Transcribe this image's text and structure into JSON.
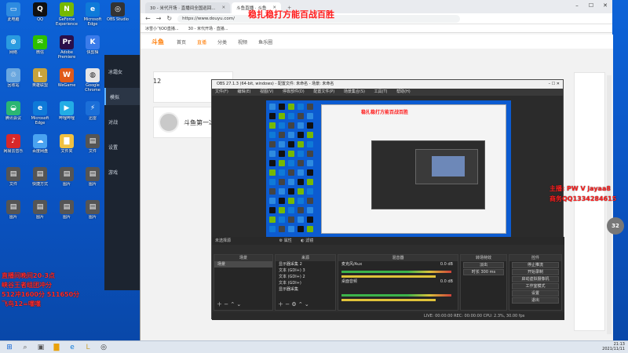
{
  "desktop": {
    "icons": [
      {
        "label": "此电脑",
        "color": "#2e8be0",
        "glyph": "▭"
      },
      {
        "label": "QQ",
        "color": "#111111",
        "glyph": "Q"
      },
      {
        "label": "GeForce Experience",
        "color": "#76b900",
        "glyph": "N"
      },
      {
        "label": "Microsoft Edge",
        "color": "#0f7ad8",
        "glyph": "e"
      },
      {
        "label": "OBS Studio",
        "color": "#333333",
        "glyph": "◎"
      },
      {
        "label": "网络",
        "color": "#2a9be0",
        "glyph": "⊕"
      },
      {
        "label": "微信",
        "color": "#2dc100",
        "glyph": "✉"
      },
      {
        "label": "Adobe Premiere",
        "color": "#2a0f4a",
        "glyph": "Pr"
      },
      {
        "label": "快剪辑",
        "color": "#3a7bea",
        "glyph": "K"
      },
      {
        "label": "小黄鸭",
        "color": "#f3c20a",
        "glyph": "◉"
      },
      {
        "label": "回收站",
        "color": "#6aa7df",
        "glyph": "♲"
      },
      {
        "label": "英雄联盟",
        "color": "#c8a33c",
        "glyph": "L"
      },
      {
        "label": "WeGame",
        "color": "#e05a1a",
        "glyph": "W"
      },
      {
        "label": "Google Chrome",
        "color": "#e6e6e6",
        "glyph": "◍"
      },
      {
        "label": "QQ音乐",
        "color": "#f7d51a",
        "glyph": "♫"
      },
      {
        "label": "腾讯会议",
        "color": "#2bb673",
        "glyph": "◒"
      },
      {
        "label": "Microsoft Edge",
        "color": "#0f7ad8",
        "glyph": "e"
      },
      {
        "label": "哔哩哔哩",
        "color": "#23ade5",
        "glyph": "▶"
      },
      {
        "label": "迅雷",
        "color": "#1b6fd8",
        "glyph": "⚡"
      },
      {
        "label": "应用",
        "color": "#ffffff",
        "glyph": "✿"
      },
      {
        "label": "网易云音乐",
        "color": "#d8282a",
        "glyph": "♪"
      },
      {
        "label": "百度网盘",
        "color": "#4aa3f0",
        "glyph": "☁"
      },
      {
        "label": "文件夹",
        "color": "#f0c040",
        "glyph": "▇"
      },
      {
        "label": "文件",
        "color": "#555555",
        "glyph": "▤"
      },
      {
        "label": "文件",
        "color": "#555555",
        "glyph": "▤"
      },
      {
        "label": "快捷方式",
        "color": "#555555",
        "glyph": "▤"
      },
      {
        "label": "图片",
        "color": "#555555",
        "glyph": "▤"
      },
      {
        "label": "图片",
        "color": "#555555",
        "glyph": "▤"
      },
      {
        "label": "图片",
        "color": "#555555",
        "glyph": "▤"
      },
      {
        "label": "图片",
        "color": "#555555",
        "glyph": "▤"
      },
      {
        "label": "图片",
        "color": "#555555",
        "glyph": "▤"
      },
      {
        "label": "图片",
        "color": "#555555",
        "glyph": "▤"
      }
    ],
    "overlay_text": [
      "直播间晚间20-3点",
      "峡谷王者组团冲分",
      "512冲1600分 511650分",
      "飞鸟12=嘿嘿"
    ]
  },
  "leftapp": {
    "items": [
      "冰霜女",
      "模拟",
      "对战",
      "设置",
      "游戏"
    ]
  },
  "browser": {
    "tabs": [
      {
        "label": "30 - 米代开场 · 直播间全国巡回...",
        "active": false
      },
      {
        "label": "斗鱼直播 · 斗鱼",
        "active": true
      }
    ],
    "url": "https://www.douyu.com/",
    "bookmarks": [
      "冰雪小飞OO直播...",
      "30 - 米代开场 · 直播..."
    ],
    "site_nav": [
      "斗鱼",
      "首页",
      "直播",
      "分类",
      "视频",
      "鱼乐圈"
    ],
    "live_count": "12",
    "room_title": "斗鱼第一冰女",
    "badge": "32",
    "stream_title": "稳扎稳打方能百战百胜",
    "red_right": [
      "主播: PW V jayaa8",
      "商务QQ1334284615"
    ]
  },
  "obs": {
    "title": "OBS 27.1.3 (64-bit, windows) - 配置文件: 未命名 - 场景: 未命名",
    "menu": [
      "文件(F)",
      "编辑(E)",
      "视图(V)",
      "停靠部件(D)",
      "配置文件(P)",
      "场景集合(S)",
      "工具(T)",
      "帮助(H)"
    ],
    "status": "未选择源",
    "props": "属性",
    "filters": "滤镜",
    "docks": {
      "scenes": {
        "head": "场景",
        "items": [
          "场景"
        ]
      },
      "sources": {
        "head": "来源",
        "items": [
          "显示器采集 2",
          "文本 (GDI+) 3",
          "文本 (GDI+) 2",
          "文本 (GDI+)",
          "显示器采集"
        ]
      },
      "mixer": {
        "head": "混音器",
        "items": [
          "麦克风/Aux",
          "桌面音频"
        ],
        "db": [
          "0.0 dB",
          "0.0 dB"
        ]
      },
      "transitions": {
        "head": "转场特效",
        "items": [
          "淡出",
          "时长 300 ms"
        ]
      },
      "controls": {
        "head": "控件",
        "items": [
          "停止推流",
          "开始录制",
          "启动虚拟摄像机",
          "工作室模式",
          "设置",
          "退出"
        ]
      }
    },
    "footer": "LIVE: 00:00:00   REC: 00:00:00   CPU: 2.3%, 30.00 fps"
  },
  "taskbar": {
    "time": "21:13",
    "date": "2021/11/11"
  }
}
